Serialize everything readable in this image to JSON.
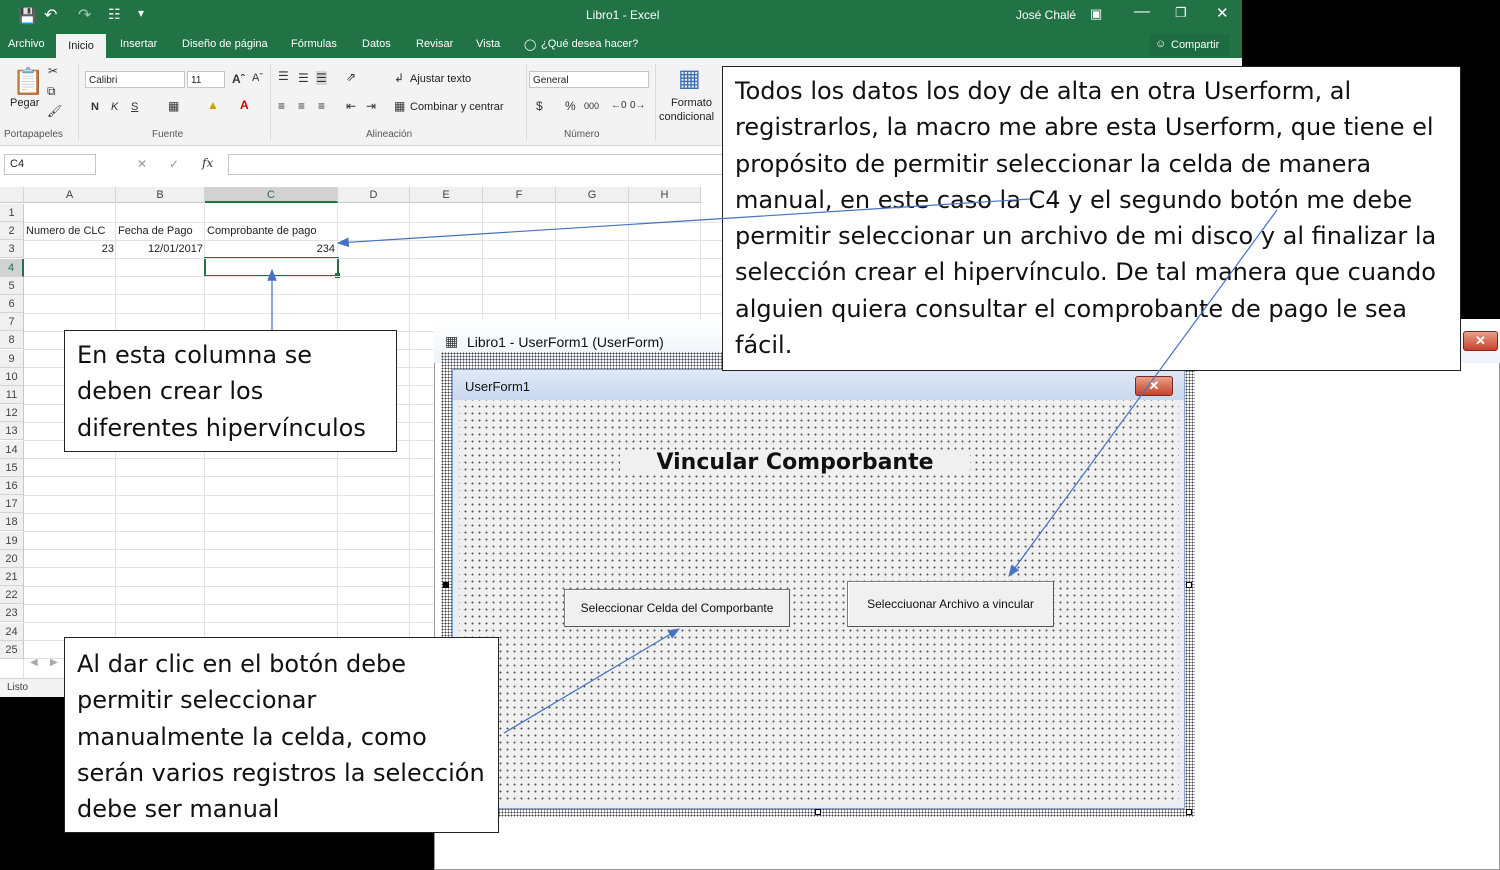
{
  "excel": {
    "title": "Libro1  -  Excel",
    "user": "José Chalé",
    "tabs": [
      "Archivo",
      "Inicio",
      "Insertar",
      "Diseño de página",
      "Fórmulas",
      "Datos",
      "Revisar",
      "Vista"
    ],
    "tell_me": "¿Qué desea hacer?",
    "share": "Compartir",
    "ribbon": {
      "paste": "Pegar",
      "font_name": "Calibri",
      "font_size": "11",
      "wrap_text": "Ajustar texto",
      "merge_center": "Combinar y centrar",
      "number_format": "General",
      "cond_format_1": "Formato",
      "cond_format_2": "condicional",
      "groups": [
        "Portapapeles",
        "Fuente",
        "Alineación",
        "Número"
      ]
    },
    "name_box": "C4",
    "columns": [
      "A",
      "B",
      "C",
      "D",
      "E",
      "F",
      "G",
      "H"
    ],
    "rows": [
      "1",
      "2",
      "3",
      "4",
      "5",
      "6",
      "7",
      "8",
      "9",
      "10",
      "11",
      "12",
      "13",
      "14",
      "15",
      "16",
      "17",
      "18",
      "19",
      "20",
      "21",
      "22",
      "23",
      "24",
      "25"
    ],
    "cells": {
      "a2": "Numero de CLC",
      "b2": "Fecha de Pago",
      "c2": "Comprobante de pago",
      "a3": "23",
      "b3": "12/01/2017",
      "c3": "234"
    },
    "status": "Listo"
  },
  "vba": {
    "window_title": "Libro1 - UserForm1 (UserForm)",
    "form_caption": "UserForm1",
    "heading": "Vincular Comporbante",
    "button_cell": "Seleccionar Celda del Comporbante",
    "button_file": "Selecciuonar Archivo a vincular"
  },
  "notes": {
    "top": "Todos los datos los doy de alta en otra Userform, al registrarlos, la macro me abre esta Userform, que tiene el propósito de permitir seleccionar la celda de manera manual, en este caso la C4 y el segundo botón me debe permitir seleccionar un archivo de mi disco y al finalizar la selección crear el hipervínculo. De tal manera que cuando alguien quiera consultar el comprobante de pago le sea fácil.",
    "column": "En esta columna se deben crear los diferentes hipervínculos",
    "click": "Al dar clic en el botón debe permitir seleccionar manualmente la celda, como serán varios registros la selección debe ser manual"
  },
  "colors": {
    "excel_green": "#217346",
    "annotation_arrow": "#4472c4",
    "selection_border": "#217346"
  }
}
